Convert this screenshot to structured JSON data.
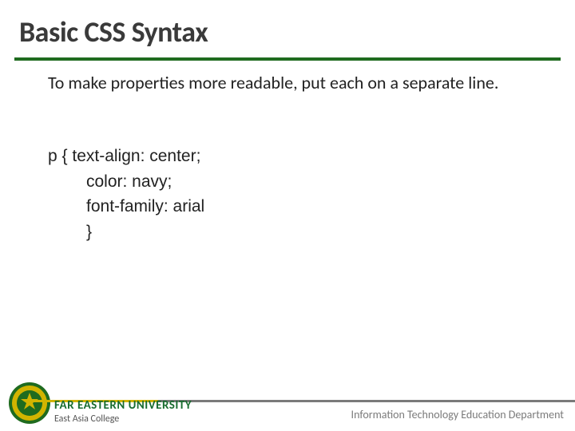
{
  "title": "Basic CSS Syntax",
  "body": "To make properties more readable, put each on a separate line.",
  "code": {
    "line1": "p { text-align: center;",
    "line2": "color: navy;",
    "line3": "font-family: arial",
    "line4": "}"
  },
  "footer": {
    "university": "FAR EASTERN UNIVERSITY",
    "college": "East Asia College",
    "department": "Information Technology Education Department"
  }
}
